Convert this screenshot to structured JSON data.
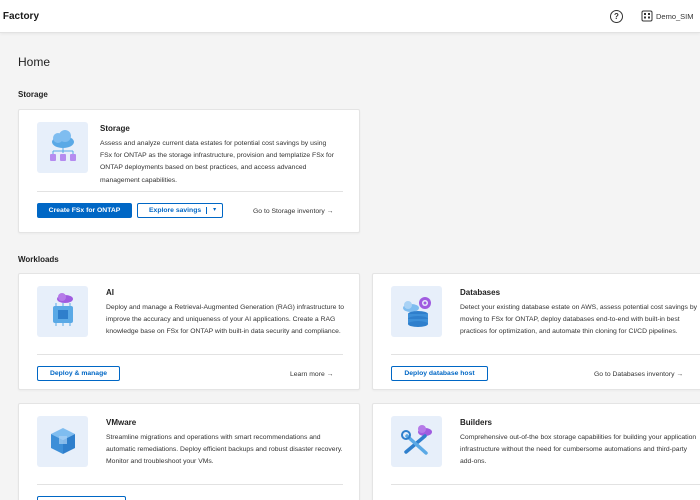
{
  "header": {
    "app_title": "d Factory",
    "help_glyph": "?",
    "account_label": "Demo_SIM"
  },
  "page": {
    "title": "Home"
  },
  "sections": {
    "storage": "Storage",
    "workloads": "Workloads"
  },
  "cards": {
    "storage": {
      "title": "Storage",
      "description": "Assess and analyze current data estates for potential cost savings by using FSx for ONTAP as the storage infrastructure, provision and templatize FSx for ONTAP deployments based on best practices, and access advanced management capabilities.",
      "primary_button": "Create FSx for ONTAP",
      "secondary_button": "Explore savings",
      "link": "Go to Storage inventory →"
    },
    "ai": {
      "title": "AI",
      "description": "Deploy and manage a Retrieval-Augmented Generation (RAG) infrastructure to improve the accuracy and uniqueness of your AI applications. Create a RAG knowledge base on FSx for ONTAP with built-in data security and compliance.",
      "button": "Deploy & manage",
      "link": "Learn more →"
    },
    "databases": {
      "title": "Databases",
      "description": "Detect your existing database estate on AWS, assess potential cost savings by moving to FSx for ONTAP, deploy databases end-to-end with built-in best practices for optimization, and automate thin cloning for CI/CD pipelines.",
      "button": "Deploy database host",
      "link": "Go to Databases inventory →"
    },
    "vmware": {
      "title": "VMware",
      "description": "Streamline migrations and operations with smart recommendations and automatic remediations. Deploy efficient backups and robust disaster recovery. Monitor and troubleshoot your VMs."
    },
    "builders": {
      "title": "Builders",
      "description": "Comprehensive out-of-the box storage capabilities for building your application infrastructure without the need for cumbersome automations and third-party add-ons."
    }
  },
  "colors": {
    "primary": "#0067c5",
    "illustration_bg": "#e7effa",
    "cloud": "#5aa9e6",
    "accent_purple": "#a05ce0",
    "page_bg": "#f4f4f4"
  },
  "icons": {
    "help": "help-circle-icon",
    "account": "account-building-icon",
    "storage_illustration": "cloud-storage-illustration",
    "ai_illustration": "ai-chip-illustration",
    "databases_illustration": "database-illustration",
    "vmware_illustration": "vm-cube-illustration",
    "builders_illustration": "builder-tools-illustration",
    "link_arrow": "arrow-right-icon",
    "dropdown": "chevron-down-icon"
  }
}
